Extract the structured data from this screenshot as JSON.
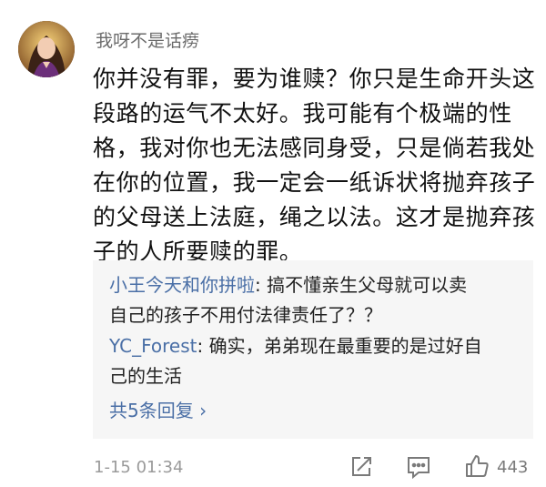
{
  "comment": {
    "username": "我呀不是话痨",
    "lines": [
      "你并没有罪，要为谁赎？你只是生命开头这",
      "段路的运气不太好。我可能有个极端的性",
      "格，我对你也无法感同身受，只是倘若我处",
      "在你的位置，我一定会一纸诉状将抛弃孩子",
      "的父母送上法庭，绳之以法。这才是抛弃孩",
      "子的人所要赎的罪。"
    ],
    "time": "1-15 01:34",
    "like_count": "443"
  },
  "replies": [
    {
      "author": "小王今天和你拼啦",
      "separator": ": ",
      "text_lines": [
        "搞不懂亲生父母就可以卖",
        "自己的孩子不用付法律责任了？？"
      ]
    },
    {
      "author": "YC_Forest",
      "separator": ": ",
      "text_lines": [
        "确实，弟弟现在最重要的是过好自",
        "己的生活"
      ]
    }
  ],
  "more_replies_label": "共5条回复 ›",
  "icons": {
    "share": "share-icon",
    "comment": "comment-icon",
    "like": "thumbs-up-icon"
  }
}
